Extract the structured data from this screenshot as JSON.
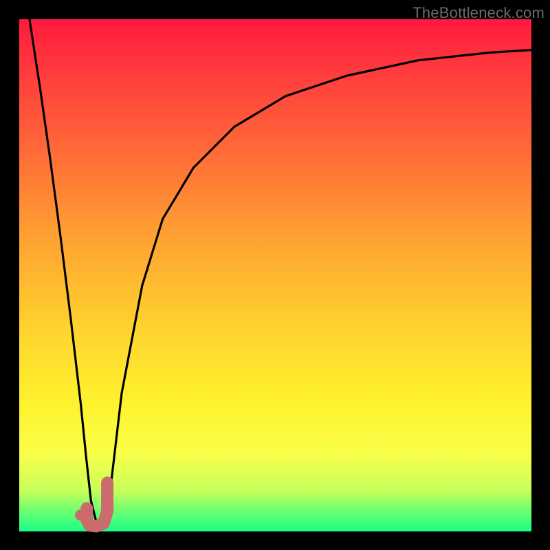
{
  "watermark": {
    "text": "TheBottleneck.com"
  },
  "chart_data": {
    "type": "line",
    "title": "",
    "xlabel": "",
    "ylabel": "",
    "xlim": [
      0,
      100
    ],
    "ylim": [
      0,
      100
    ],
    "series": [
      {
        "name": "bottleneck-curve",
        "x": [
          2,
          4,
          6,
          8,
          10,
          12,
          13,
          14,
          15,
          16,
          17,
          18,
          20,
          24,
          28,
          34,
          42,
          52,
          64,
          78,
          92,
          100
        ],
        "values": [
          100,
          87,
          73,
          58,
          42,
          25,
          15,
          6,
          2,
          1,
          3,
          10,
          27,
          48,
          61,
          71,
          79,
          85,
          89,
          92,
          93.5,
          94
        ]
      }
    ],
    "marker": {
      "name": "J-shape",
      "color": "#cc6b6b",
      "points_x": [
        13.2,
        13.2,
        13.7,
        15.0,
        16.5,
        17.2,
        17.2
      ],
      "points_y": [
        4.5,
        2.2,
        1.2,
        1.0,
        1.6,
        4.0,
        9.5
      ]
    },
    "marker_dot": {
      "x": 12.0,
      "y": 3.2,
      "r": 1.1,
      "color": "#cc6b6b"
    },
    "gradient_stops": [
      {
        "pos": 0,
        "color": "#ff1a3e"
      },
      {
        "pos": 25,
        "color": "#ff6838"
      },
      {
        "pos": 60,
        "color": "#ffd22e"
      },
      {
        "pos": 85,
        "color": "#f8ff4a"
      },
      {
        "pos": 100,
        "color": "#1aff87"
      }
    ]
  }
}
